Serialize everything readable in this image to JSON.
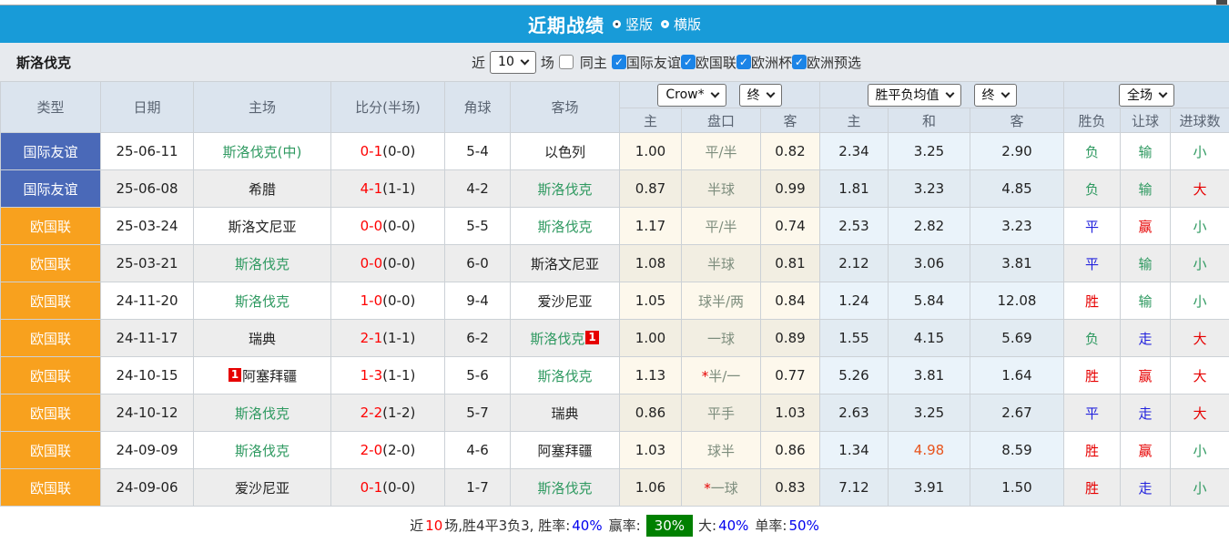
{
  "title_bar": {
    "title": "近期战绩",
    "radio_vertical": "竖版",
    "radio_horizontal": "横版"
  },
  "filter": {
    "team": "斯洛伐克",
    "near_label": "近",
    "matches_count": "10",
    "matches_label": "场",
    "same_home_label": "同主",
    "leagues": [
      {
        "label": "国际友谊",
        "checked": true
      },
      {
        "label": "欧国联",
        "checked": true
      },
      {
        "label": "欧洲杯",
        "checked": true
      },
      {
        "label": "欧洲预选",
        "checked": true
      }
    ]
  },
  "table": {
    "headers": {
      "type": "类型",
      "date": "日期",
      "home": "主场",
      "score": "比分(半场)",
      "corners": "角球",
      "away": "客场",
      "odds_home": "主",
      "odds_handicap": "盘口",
      "odds_away": "客",
      "avg_home": "主",
      "avg_draw": "和",
      "avg_away": "客",
      "result_wdl": "胜负",
      "result_handicap": "让球",
      "result_goals": "进球数"
    },
    "dropdowns": {
      "bookmaker": "Crow*",
      "bookmaker_time": "终",
      "avg": "胜平负均值",
      "avg_time": "终",
      "scope": "全场"
    },
    "rows": [
      {
        "type": "国际友谊",
        "league_color": "blue",
        "date": "25-06-11",
        "home": {
          "name": "斯洛伐克(中)",
          "green": true,
          "card": ""
        },
        "ft": "0-1",
        "ht": "(0-0)",
        "corners": "5-4",
        "away": {
          "name": "以色列",
          "green": false,
          "card": ""
        },
        "odds": [
          "1.00",
          "平/半",
          "0.82"
        ],
        "avg": [
          "2.34",
          "3.25",
          "2.90"
        ],
        "avg_red": -1,
        "results": [
          "负",
          "输",
          "小"
        ]
      },
      {
        "type": "国际友谊",
        "league_color": "blue",
        "date": "25-06-08",
        "home": {
          "name": "希腊",
          "green": false,
          "card": ""
        },
        "ft": "4-1",
        "ht": "(1-1)",
        "corners": "4-2",
        "away": {
          "name": "斯洛伐克",
          "green": true,
          "card": ""
        },
        "odds": [
          "0.87",
          "半球",
          "0.99"
        ],
        "avg": [
          "1.81",
          "3.23",
          "4.85"
        ],
        "avg_red": -1,
        "results": [
          "负",
          "输",
          "大"
        ]
      },
      {
        "type": "欧国联",
        "league_color": "orange",
        "date": "25-03-24",
        "home": {
          "name": "斯洛文尼亚",
          "green": false,
          "card": ""
        },
        "ft": "0-0",
        "ht": "(0-0)",
        "corners": "5-5",
        "away": {
          "name": "斯洛伐克",
          "green": true,
          "card": ""
        },
        "odds": [
          "1.17",
          "平/半",
          "0.74"
        ],
        "avg": [
          "2.53",
          "2.82",
          "3.23"
        ],
        "avg_red": -1,
        "results": [
          "平",
          "赢",
          "小"
        ]
      },
      {
        "type": "欧国联",
        "league_color": "orange",
        "date": "25-03-21",
        "home": {
          "name": "斯洛伐克",
          "green": true,
          "card": ""
        },
        "ft": "0-0",
        "ht": "(0-0)",
        "corners": "6-0",
        "away": {
          "name": "斯洛文尼亚",
          "green": false,
          "card": ""
        },
        "odds": [
          "1.08",
          "半球",
          "0.81"
        ],
        "avg": [
          "2.12",
          "3.06",
          "3.81"
        ],
        "avg_red": -1,
        "results": [
          "平",
          "输",
          "小"
        ]
      },
      {
        "type": "欧国联",
        "league_color": "orange",
        "date": "24-11-20",
        "home": {
          "name": "斯洛伐克",
          "green": true,
          "card": ""
        },
        "ft": "1-0",
        "ht": "(0-0)",
        "corners": "9-4",
        "away": {
          "name": "爱沙尼亚",
          "green": false,
          "card": ""
        },
        "odds": [
          "1.05",
          "球半/两",
          "0.84"
        ],
        "avg": [
          "1.24",
          "5.84",
          "12.08"
        ],
        "avg_red": -1,
        "results": [
          "胜",
          "输",
          "小"
        ]
      },
      {
        "type": "欧国联",
        "league_color": "orange",
        "date": "24-11-17",
        "home": {
          "name": "瑞典",
          "green": false,
          "card": ""
        },
        "ft": "2-1",
        "ht": "(1-1)",
        "corners": "6-2",
        "away": {
          "name": "斯洛伐克",
          "green": true,
          "card": "1"
        },
        "odds": [
          "1.00",
          "一球",
          "0.89"
        ],
        "avg": [
          "1.55",
          "4.15",
          "5.69"
        ],
        "avg_red": -1,
        "results": [
          "负",
          "走",
          "大"
        ]
      },
      {
        "type": "欧国联",
        "league_color": "orange",
        "date": "24-10-15",
        "home": {
          "name": "阿塞拜疆",
          "green": false,
          "card": "1"
        },
        "ft": "1-3",
        "ht": "(1-1)",
        "corners": "5-6",
        "away": {
          "name": "斯洛伐克",
          "green": true,
          "card": ""
        },
        "odds": [
          "1.13",
          "*半/一",
          "0.77"
        ],
        "avg": [
          "5.26",
          "3.81",
          "1.64"
        ],
        "avg_red": -1,
        "results": [
          "胜",
          "赢",
          "大"
        ]
      },
      {
        "type": "欧国联",
        "league_color": "orange",
        "date": "24-10-12",
        "home": {
          "name": "斯洛伐克",
          "green": true,
          "card": ""
        },
        "ft": "2-2",
        "ht": "(1-2)",
        "corners": "5-7",
        "away": {
          "name": "瑞典",
          "green": false,
          "card": ""
        },
        "odds": [
          "0.86",
          "平手",
          "1.03"
        ],
        "avg": [
          "2.63",
          "3.25",
          "2.67"
        ],
        "avg_red": -1,
        "results": [
          "平",
          "走",
          "大"
        ]
      },
      {
        "type": "欧国联",
        "league_color": "orange",
        "date": "24-09-09",
        "home": {
          "name": "斯洛伐克",
          "green": true,
          "card": ""
        },
        "ft": "2-0",
        "ht": "(2-0)",
        "corners": "4-6",
        "away": {
          "name": "阿塞拜疆",
          "green": false,
          "card": ""
        },
        "odds": [
          "1.03",
          "球半",
          "0.86"
        ],
        "avg": [
          "1.34",
          "4.98",
          "8.59"
        ],
        "avg_red": 1,
        "results": [
          "胜",
          "赢",
          "小"
        ]
      },
      {
        "type": "欧国联",
        "league_color": "orange",
        "date": "24-09-06",
        "home": {
          "name": "爱沙尼亚",
          "green": false,
          "card": ""
        },
        "ft": "0-1",
        "ht": "(0-0)",
        "corners": "1-7",
        "away": {
          "name": "斯洛伐克",
          "green": true,
          "card": ""
        },
        "odds": [
          "1.06",
          "*一球",
          "0.83"
        ],
        "avg": [
          "7.12",
          "3.91",
          "1.50"
        ],
        "avg_red": -1,
        "results": [
          "胜",
          "走",
          "小"
        ]
      }
    ]
  },
  "footer": {
    "parts": {
      "prefix": "近",
      "count": "10",
      "stats": "场,胜4平3负3, 胜率:",
      "win_rate": "40%",
      "mid1": "赢率:",
      "highlight_rate": "30%",
      "mid2": "大:",
      "big_rate": "40%",
      "mid3": "单率:",
      "single_rate": "50%"
    }
  },
  "colors": {
    "accent_bar": "#189bd8",
    "type_blue": "#4a69b8",
    "type_orange": "#f8a11e",
    "team_green": "#2e9960",
    "score_red": "#fe0000",
    "handicap_gray_green": "#7d8d7d",
    "avg_highlight": "#e8541d",
    "rate_blue": "#0000ee",
    "count_red": "#ff0000",
    "win_rate_bg": "#008000",
    "outcome_colors": {
      "胜": "#e60000",
      "平": "#2323dd",
      "负": "#2e9960",
      "赢": "#e60000",
      "输": "#2e9960",
      "走": "#2323dd",
      "大": "#e60000",
      "小": "#2e9960"
    }
  }
}
